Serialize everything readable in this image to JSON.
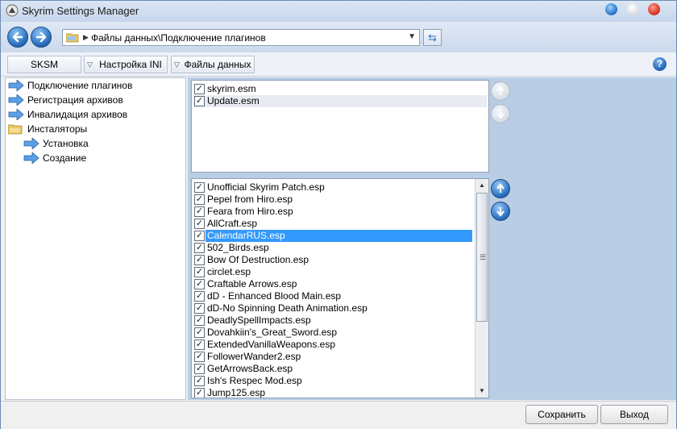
{
  "window": {
    "title": "Skyrim Settings Manager",
    "icon": "skyrim-logo-icon"
  },
  "nav": {
    "back_icon": "back-arrow-icon",
    "forward_icon": "forward-arrow-icon",
    "address": "Файлы данных\\Подключение плагинов",
    "refresh_icon": "refresh-icon"
  },
  "menu": {
    "items": [
      {
        "label": "SKSM"
      },
      {
        "label": "Настройка INI"
      },
      {
        "label": "Файлы данных"
      }
    ],
    "help_icon": "help-icon"
  },
  "tree": {
    "items": [
      {
        "label": "Подключение плагинов",
        "icon": "arrow-right-icon"
      },
      {
        "label": "Регистрация архивов",
        "icon": "arrow-right-icon"
      },
      {
        "label": "Инвалидация архивов",
        "icon": "arrow-right-icon"
      },
      {
        "label": "Инсталяторы",
        "icon": "folder-icon"
      },
      {
        "label": "Установка",
        "icon": "arrow-right-icon"
      },
      {
        "label": "Создание",
        "icon": "arrow-right-icon"
      }
    ]
  },
  "masters": {
    "items": [
      {
        "label": "skyrim.esm",
        "checked": true
      },
      {
        "label": "Update.esm",
        "checked": true
      }
    ]
  },
  "plugins": {
    "selected": "CalendarRUS.esp",
    "items": [
      {
        "label": "Unofficial Skyrim Patch.esp",
        "checked": true
      },
      {
        "label": "Pepel from Hiro.esp",
        "checked": true
      },
      {
        "label": "Feara from Hiro.esp",
        "checked": true
      },
      {
        "label": "AllCraft.esp",
        "checked": true
      },
      {
        "label": "CalendarRUS.esp",
        "checked": true
      },
      {
        "label": "502_Birds.esp",
        "checked": true
      },
      {
        "label": "Bow Of Destruction.esp",
        "checked": true
      },
      {
        "label": "circlet.esp",
        "checked": true
      },
      {
        "label": "Craftable Arrows.esp",
        "checked": true
      },
      {
        "label": "dD - Enhanced Blood Main.esp",
        "checked": true
      },
      {
        "label": "dD-No Spinning Death Animation.esp",
        "checked": true
      },
      {
        "label": "DeadlySpellImpacts.esp",
        "checked": true
      },
      {
        "label": "Dovahkiin's_Great_Sword.esp",
        "checked": true
      },
      {
        "label": "ExtendedVanillaWeapons.esp",
        "checked": true
      },
      {
        "label": "FollowerWander2.esp",
        "checked": true
      },
      {
        "label": "GetArrowsBack.esp",
        "checked": true
      },
      {
        "label": "Ish's Respec Mod.esp",
        "checked": true
      },
      {
        "label": "Jump125.esp",
        "checked": true
      }
    ]
  },
  "footer": {
    "save_label": "Сохранить",
    "exit_label": "Выход"
  },
  "colors": {
    "selection": "#3399ff",
    "panel_bg": "#b9cde5",
    "accent": "#2a6fc0"
  }
}
